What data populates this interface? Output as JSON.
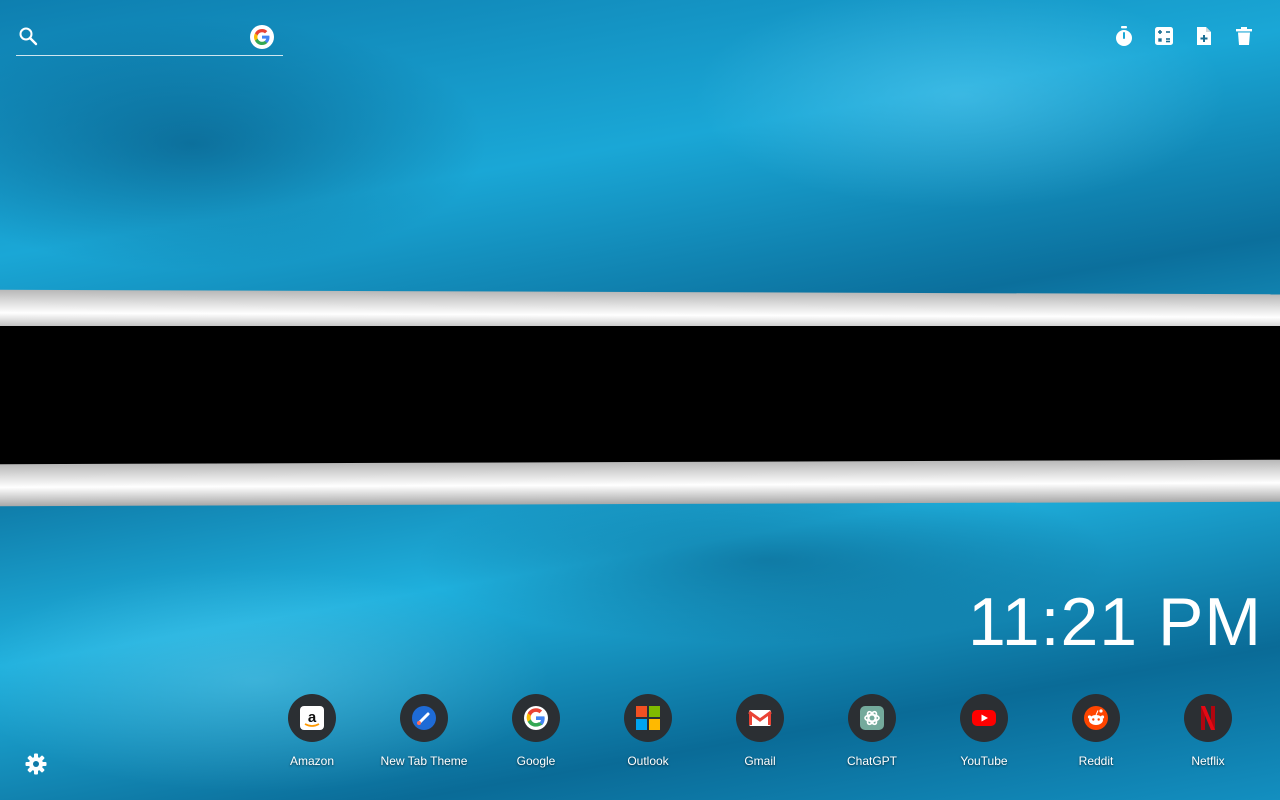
{
  "search": {
    "placeholder": "",
    "engine_icon": "google-icon"
  },
  "tools": [
    {
      "name": "timer-icon"
    },
    {
      "name": "calculator-icon"
    },
    {
      "name": "add-note-icon"
    },
    {
      "name": "trash-icon"
    }
  ],
  "clock": {
    "time": "11:21 PM"
  },
  "shortcuts": [
    {
      "label": "Amazon",
      "icon": "amazon-icon"
    },
    {
      "label": "New Tab Theme",
      "icon": "new-tab-theme-icon"
    },
    {
      "label": "Google",
      "icon": "google-icon"
    },
    {
      "label": "Outlook",
      "icon": "outlook-icon"
    },
    {
      "label": "Gmail",
      "icon": "gmail-icon"
    },
    {
      "label": "ChatGPT",
      "icon": "chatgpt-icon"
    },
    {
      "label": "YouTube",
      "icon": "youtube-icon"
    },
    {
      "label": "Reddit",
      "icon": "reddit-icon"
    },
    {
      "label": "Netflix",
      "icon": "netflix-icon"
    }
  ],
  "settings": {
    "icon": "gear-icon"
  },
  "background": {
    "description_colors": {
      "blue": "#1aa7d6",
      "white": "#ffffff",
      "black": "#000000"
    }
  },
  "colors": {
    "shortcut_bg": "#2b2f33",
    "text": "#ffffff"
  }
}
